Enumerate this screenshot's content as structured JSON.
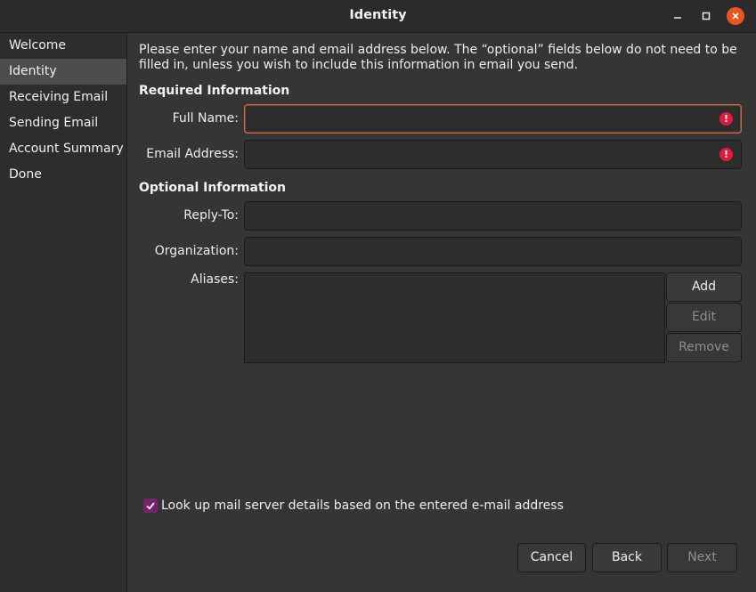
{
  "window": {
    "title": "Identity"
  },
  "sidebar": {
    "items": [
      {
        "label": "Welcome",
        "active": false
      },
      {
        "label": "Identity",
        "active": true
      },
      {
        "label": "Receiving Email",
        "active": false
      },
      {
        "label": "Sending Email",
        "active": false
      },
      {
        "label": "Account Summary",
        "active": false
      },
      {
        "label": "Done",
        "active": false
      }
    ]
  },
  "main": {
    "intro": "Please enter your name and email address below. The “optional” fields below do not need to be filled in, unless you wish to include this information in email you send.",
    "required_heading": "Required Information",
    "optional_heading": "Optional Information",
    "fields": {
      "full_name": {
        "label": "Full Name:",
        "value": "",
        "warning": true
      },
      "email": {
        "label": "Email Address:",
        "value": "",
        "warning": true
      },
      "reply_to": {
        "label": "Reply-To:",
        "value": ""
      },
      "organization": {
        "label": "Organization:",
        "value": ""
      },
      "aliases": {
        "label": "Aliases:"
      }
    },
    "alias_buttons": {
      "add": "Add",
      "edit": "Edit",
      "remove": "Remove"
    },
    "lookup_checkbox": {
      "label": "Look up mail server details based on the entered e-mail address",
      "checked": true
    },
    "footer": {
      "cancel": "Cancel",
      "back": "Back",
      "next": "Next"
    }
  },
  "colors": {
    "accent": "#e95420",
    "checkbox": "#77216f",
    "warning": "#e01b3c"
  }
}
